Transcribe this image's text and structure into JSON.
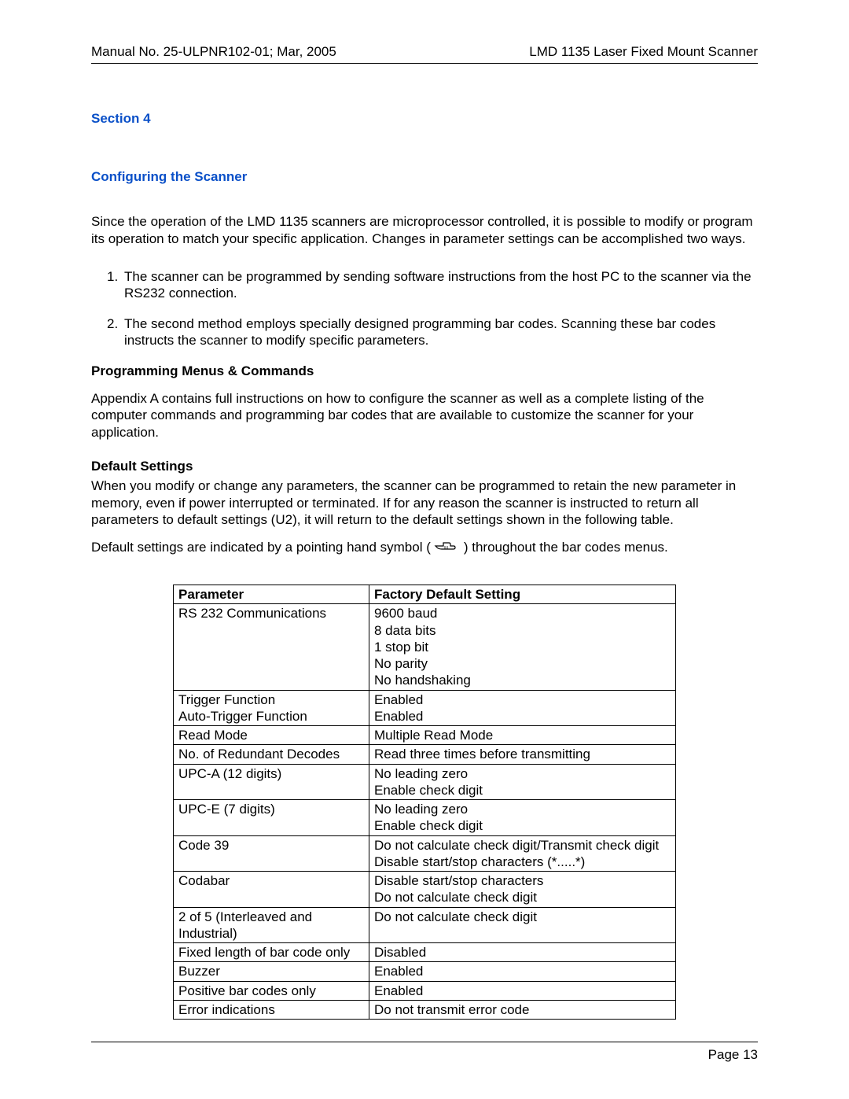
{
  "header": {
    "left": "Manual No. 25-ULPNR102-01; Mar, 2005",
    "right": "LMD 1135 Laser Fixed Mount Scanner"
  },
  "section_label": "Section 4",
  "section_title": "Configuring the Scanner",
  "intro_paragraph": "Since the operation of the LMD 1135 scanners are microprocessor controlled, it is possible to modify or program its operation to match your specific application.  Changes in parameter settings can be accomplished two ways.",
  "list": {
    "items": [
      {
        "num": "1.",
        "text": "The scanner can be programmed by sending software instructions from the host PC to the scanner via the RS232 connection."
      },
      {
        "num": "2.",
        "text": "The second method employs specially designed programming bar codes.  Scanning these bar codes instructs the scanner to modify specific parameters."
      }
    ]
  },
  "menus_heading": "Programming Menus & Commands",
  "menus_paragraph": "Appendix A contains full instructions on how to configure the scanner as well as a complete listing of the computer commands and programming bar codes that are available to customize the scanner for your application.",
  "defaults_heading": "Default Settings",
  "defaults_paragraph": "When you modify or change any parameters, the scanner can be programmed to retain the new parameter in memory, even if power interrupted or terminated.   If for any reason the scanner is instructed to return all parameters to default settings (U2), it will return to the default settings shown in the following table.",
  "hand_line_pre": "Default settings are indicated by a pointing hand symbol ( ",
  "hand_line_post": " ) throughout the bar codes menus.",
  "table": {
    "headers": [
      "Parameter",
      "Factory Default Setting"
    ],
    "rows": [
      {
        "param": "RS 232 Communications",
        "value": "9600 baud\n8 data bits\n1 stop bit\nNo parity\nNo handshaking"
      },
      {
        "param": "Trigger Function\nAuto-Trigger Function",
        "value": "Enabled\nEnabled"
      },
      {
        "param": "Read Mode",
        "value": "Multiple Read Mode"
      },
      {
        "param": "No. of Redundant Decodes",
        "value": "Read three times before transmitting"
      },
      {
        "param": "UPC-A  (12 digits)",
        "value": "No leading zero\nEnable check digit"
      },
      {
        "param": "UPC-E  (7 digits)",
        "value": "No leading zero\nEnable check digit"
      },
      {
        "param": "Code 39",
        "value": "Do not calculate check digit/Transmit check digit\nDisable start/stop characters   (*.....*)"
      },
      {
        "param": "Codabar",
        "value": "Disable start/stop characters\nDo not calculate check digit"
      },
      {
        "param": "2 of 5 (Interleaved and Industrial)",
        "value": "Do not calculate check digit"
      },
      {
        "param": "Fixed length of bar code only",
        "value": "Disabled"
      },
      {
        "param": "Buzzer",
        "value": "Enabled"
      },
      {
        "param": "Positive bar codes only",
        "value": "Enabled"
      },
      {
        "param": "Error indications",
        "value": "Do not transmit error code"
      }
    ]
  },
  "footer": {
    "page": "Page  13"
  },
  "chart_data": {
    "type": "table",
    "title": "Factory Default Settings",
    "columns": [
      "Parameter",
      "Factory Default Setting"
    ],
    "rows": [
      [
        "RS 232 Communications",
        "9600 baud; 8 data bits; 1 stop bit; No parity; No handshaking"
      ],
      [
        "Trigger Function",
        "Enabled"
      ],
      [
        "Auto-Trigger Function",
        "Enabled"
      ],
      [
        "Read Mode",
        "Multiple Read Mode"
      ],
      [
        "No. of Redundant Decodes",
        "Read three times before transmitting"
      ],
      [
        "UPC-A (12 digits)",
        "No leading zero; Enable check digit"
      ],
      [
        "UPC-E (7 digits)",
        "No leading zero; Enable check digit"
      ],
      [
        "Code 39",
        "Do not calculate check digit/Transmit check digit; Disable start/stop characters (*.....*)"
      ],
      [
        "Codabar",
        "Disable start/stop characters; Do not calculate check digit"
      ],
      [
        "2 of 5 (Interleaved and Industrial)",
        "Do not calculate check digit"
      ],
      [
        "Fixed length of bar code only",
        "Disabled"
      ],
      [
        "Buzzer",
        "Enabled"
      ],
      [
        "Positive bar codes only",
        "Enabled"
      ],
      [
        "Error indications",
        "Do not transmit error code"
      ]
    ]
  }
}
